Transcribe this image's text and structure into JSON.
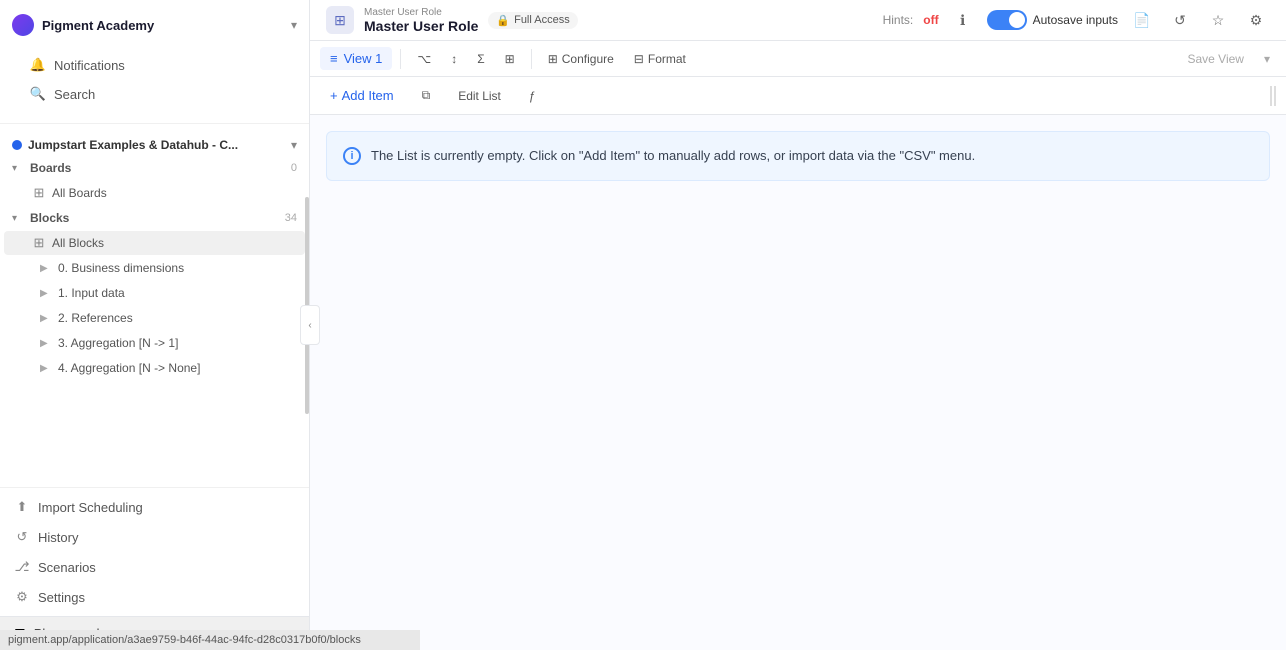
{
  "app": {
    "name": "Pigment Academy",
    "logo_color": "#7c3aed"
  },
  "workspace": {
    "name": "Jumpstart Examples & Datahub - C...",
    "chevron": "▾"
  },
  "sidebar": {
    "nav_items": [
      {
        "id": "notifications",
        "label": "Notifications",
        "icon": "bell"
      },
      {
        "id": "search",
        "label": "Search",
        "icon": "search"
      }
    ],
    "boards_section": {
      "label": "Boards",
      "count": "0",
      "items": [
        {
          "id": "all-boards",
          "label": "All Boards"
        }
      ]
    },
    "blocks_section": {
      "label": "Blocks",
      "count": "34",
      "all_blocks_label": "All Blocks",
      "items": [
        {
          "id": "business-dimensions",
          "label": "0. Business dimensions"
        },
        {
          "id": "input-data",
          "label": "1. Input data"
        },
        {
          "id": "references",
          "label": "2. References"
        },
        {
          "id": "aggregation-n1",
          "label": "3. Aggregation [N -> 1]"
        },
        {
          "id": "aggregation-nnone",
          "label": "4. Aggregation [N -> None]"
        }
      ]
    },
    "bottom_items": [
      {
        "id": "import-scheduling",
        "label": "Import Scheduling",
        "icon": "upload"
      },
      {
        "id": "history",
        "label": "History",
        "icon": "clock"
      },
      {
        "id": "scenarios",
        "label": "Scenarios",
        "icon": "git-branch"
      },
      {
        "id": "settings",
        "label": "Settings",
        "icon": "gear"
      }
    ],
    "playground_label": "Playground"
  },
  "header": {
    "module_icon": "⊞",
    "supertitle": "Master User Role",
    "title": "Master User Role",
    "full_access_label": "Full Access",
    "hints_label": "Hints:",
    "hints_value": "off",
    "autosave_label": "Autosave inputs",
    "info_icon": "i"
  },
  "toolbar": {
    "view_icon": "≡",
    "view_label": "View 1",
    "filter_icon": "⌥",
    "sort_icon": "↕",
    "aggregate_icon": "Σ",
    "table_icon": "⊞",
    "configure_label": "Configure",
    "format_label": "Format",
    "save_view_label": "Save View",
    "chevron_down": "▾"
  },
  "action_bar": {
    "add_item_label": "Add Item",
    "add_icon": "+",
    "duplicate_icon": "⧉",
    "edit_list_label": "Edit List",
    "function_icon": "ƒ"
  },
  "content": {
    "empty_message": "The List is currently empty. Click on \"Add Item\" to manually add rows, or import data via the \"CSV\" menu.",
    "info_icon": "i"
  },
  "status_bar": {
    "url": "pigment.app/application/a3ae9759-b46f-44ac-94fc-d28c0317b0f0/blocks"
  }
}
